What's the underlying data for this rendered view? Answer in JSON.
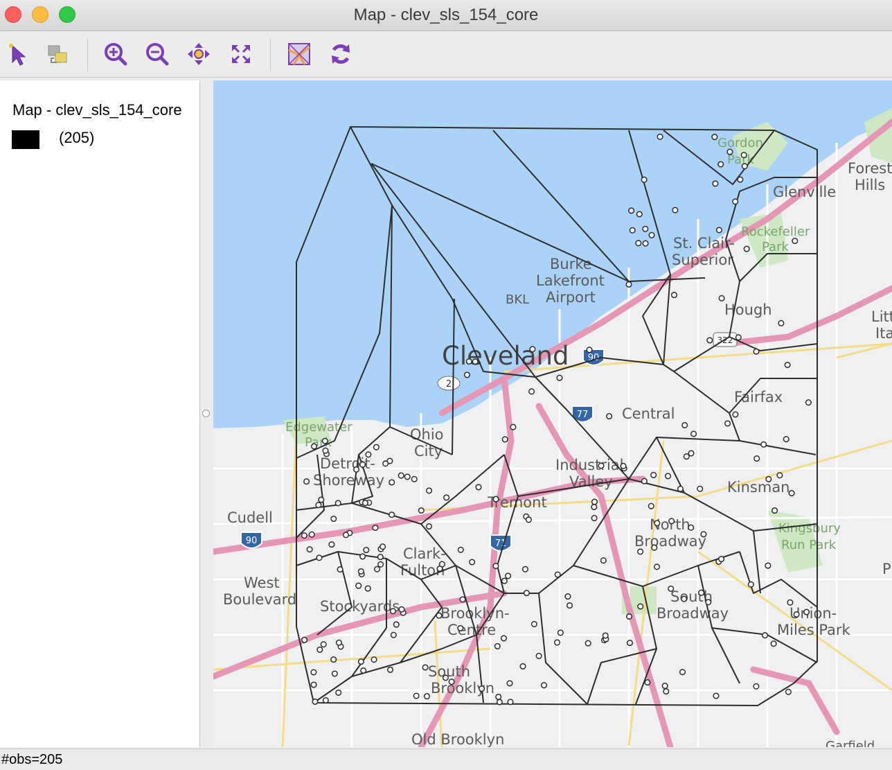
{
  "window": {
    "title": "Map - clev_sls_154_core"
  },
  "toolbar": {
    "buttons": [
      {
        "name": "select-tool",
        "icon": "pointer-arrow-icon"
      },
      {
        "name": "selection-shape-tool",
        "icon": "select-shape-icon"
      },
      {
        "name": "zoom-in-tool",
        "icon": "zoom-in-icon"
      },
      {
        "name": "zoom-out-tool",
        "icon": "zoom-out-icon"
      },
      {
        "name": "pan-tool",
        "icon": "pan-move-icon"
      },
      {
        "name": "full-extent-tool",
        "icon": "full-extent-icon"
      },
      {
        "name": "basemap-tool",
        "icon": "basemap-icon"
      },
      {
        "name": "refresh-tool",
        "icon": "refresh-icon"
      }
    ],
    "accent": "#7a3fb5"
  },
  "legend": {
    "layer_title": "Map - clev_sls_154_core",
    "category_count": "(205)",
    "swatch_color": "#000000"
  },
  "map": {
    "water_color": "#abd3f7",
    "land_color": "#eef0f2",
    "highway_color": "#e596b4",
    "place_labels": [
      "Cleveland",
      "Burke",
      "Lakefront",
      "Airport",
      "BKL",
      "Gordon",
      "Park",
      "Forest",
      "Hills",
      "Glenville",
      "St. Clair-",
      "Superior",
      "Rockefeller",
      "Park",
      "Hough",
      "Little",
      "Italy",
      "Fairfax",
      "Central",
      "Ohio",
      "City",
      "Edgewater",
      "Park",
      "Detroit-",
      "Shoreway",
      "Industrial",
      "Valley",
      "Tremont",
      "Cudell",
      "Kinsman",
      "North",
      "Broadway",
      "Kingsbury",
      "Run Park",
      "West",
      "Boulevard",
      "Clark-",
      "Fulton",
      "Stockyards",
      "Brooklyn-",
      "Centre",
      "South",
      "Broadway",
      "Union-",
      "Miles Park",
      "South",
      "Brooklyn",
      "Old Brooklyn",
      "Garfield",
      "P"
    ],
    "highway_shields": [
      "90",
      "90",
      "71",
      "77",
      "2",
      "322"
    ]
  },
  "status": {
    "text": "#obs=205"
  }
}
